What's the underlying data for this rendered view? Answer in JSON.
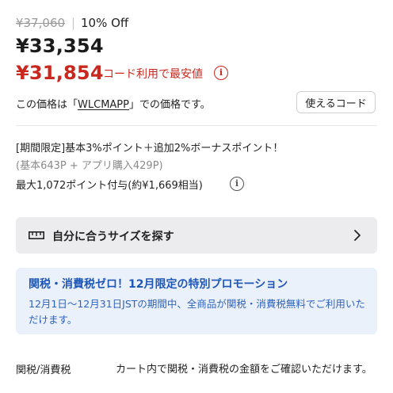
{
  "pricing": {
    "original_price": "¥37,060",
    "separator": "|",
    "discount": "10% Off",
    "price": "¥33,354",
    "coupon_price": "¥31,854",
    "coupon_note": "コード利用で最安値",
    "code_prefix": "この価格は「",
    "code": "WLCMAPP",
    "code_suffix": "」での価格です。",
    "use_code_button": "使えるコード"
  },
  "points": {
    "line1": "[期間限定]基本3%ポイント＋追加2%ボーナスポイント！",
    "line2": "(基本643P + アプリ購入429P)",
    "line3": "最大1,072ポイント付与(約¥1,669相当)"
  },
  "size_finder": {
    "label": "自分に合うサイズを探す",
    "icon": "ruler-icon"
  },
  "promotion": {
    "title": "関税・消費税ゼロ！12月限定の特別プロモーション",
    "body": "12月1日〜12月31日JSTの期間中、全商品が関税・消費税無料でご利用いただけます。"
  },
  "duties": {
    "label": "関税/消費税",
    "body": "カート内で関税・消費税の金額をご確認いただけます。"
  },
  "colors": {
    "accent_red": "#c8281e",
    "promo_blue": "#1f57b6",
    "promo_bg": "#eaf1fb"
  }
}
